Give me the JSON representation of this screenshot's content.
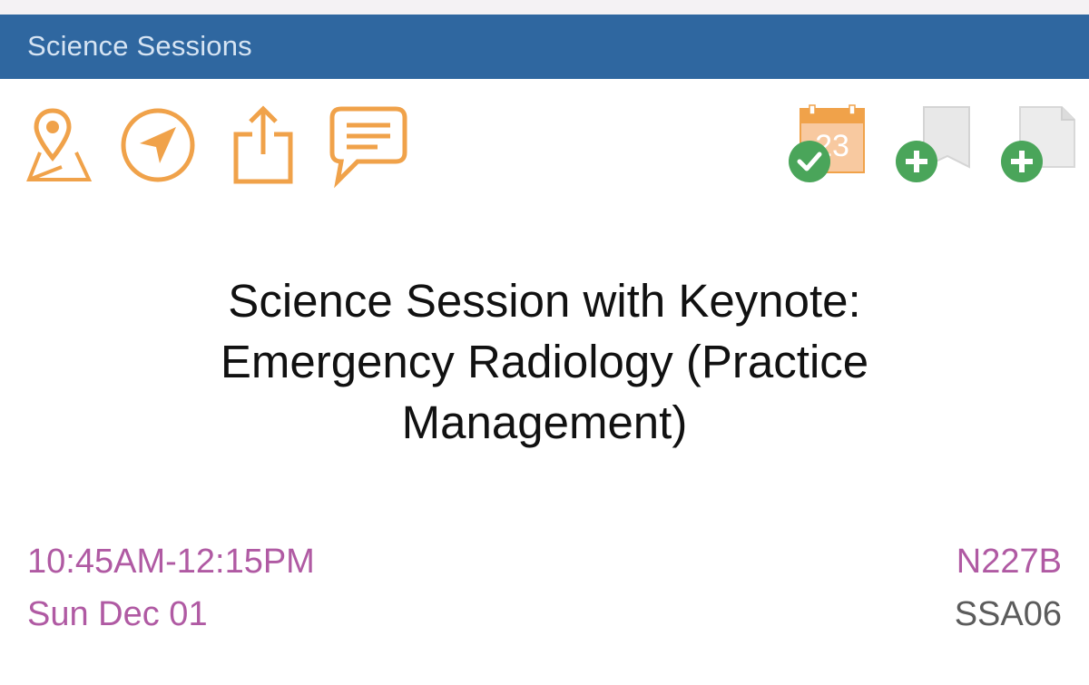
{
  "header": {
    "title": "Science Sessions"
  },
  "toolbar": {
    "left_icons": [
      "map-pin-icon",
      "navigation-arrow-icon",
      "share-icon",
      "chat-bubble-icon"
    ],
    "right_icons": [
      "calendar-added-icon",
      "bookmark-add-icon",
      "note-add-icon"
    ],
    "calendar_day": "23"
  },
  "session": {
    "title": "Science Session with Keynote: Emergency Radiology (Practice Management)",
    "time_range": "10:45AM-12:15PM",
    "date": "Sun Dec 01",
    "room": "N227B",
    "code": "SSA06"
  },
  "colors": {
    "nav_background": "#2f67a0",
    "accent_orange": "#f0a24a",
    "date_purple": "#b05aa3",
    "add_green": "#4aa55a"
  }
}
